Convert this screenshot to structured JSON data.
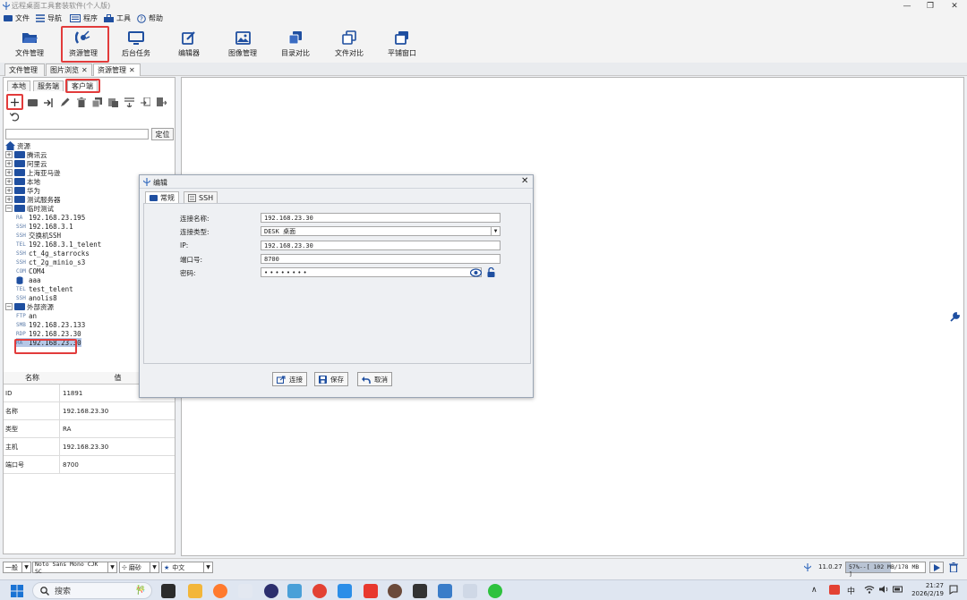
{
  "window": {
    "title": "远程桌面工具套装软件(个人版)"
  },
  "menubar": [
    {
      "label": "文件",
      "icon": "folder-icon"
    },
    {
      "label": "导航",
      "icon": "list-icon"
    },
    {
      "label": "程序",
      "icon": "keyboard-icon"
    },
    {
      "label": "工具",
      "icon": "toolbox-icon"
    },
    {
      "label": "帮助",
      "icon": "help-icon"
    }
  ],
  "toolbar": [
    {
      "label": "文件管理",
      "icon": "folder-open-icon"
    },
    {
      "label": "资源管理",
      "icon": "satellite-icon"
    },
    {
      "label": "后台任务",
      "icon": "monitor-icon"
    },
    {
      "label": "编辑器",
      "icon": "edit-icon"
    },
    {
      "label": "图像管理",
      "icon": "image-icon"
    },
    {
      "label": "目录对比",
      "icon": "copy-icon"
    },
    {
      "label": "文件对比",
      "icon": "files-icon"
    },
    {
      "label": "平铺窗口",
      "icon": "windows-icon"
    }
  ],
  "doc_tabs": [
    {
      "label": "文件管理",
      "closable": false
    },
    {
      "label": "图片浏览",
      "closable": true
    },
    {
      "label": "资源管理",
      "closable": true
    }
  ],
  "side_tabs": [
    "本地",
    "服务端",
    "客户端"
  ],
  "locate_button": "定位",
  "tree": {
    "root": "资源",
    "folders": [
      "腾讯云",
      "阿里云",
      "上海亚马逊",
      "本地",
      "华为",
      "测试服务器",
      "临时测试"
    ],
    "items": [
      {
        "tag": "RA",
        "label": "192.168.23.195"
      },
      {
        "tag": "SSH",
        "label": "192.168.3.1"
      },
      {
        "tag": "SSH",
        "label": "交换机SSH"
      },
      {
        "tag": "TEL",
        "label": "192.168.3.1_telent"
      },
      {
        "tag": "SSH",
        "label": "ct_4g_starrocks"
      },
      {
        "tag": "SSH",
        "label": "ct_2g_minio_s3"
      },
      {
        "tag": "COM",
        "label": "COM4"
      },
      {
        "tag": "DB",
        "label": "aaa"
      },
      {
        "tag": "TEL",
        "label": "test_telent"
      },
      {
        "tag": "SSH",
        "label": "anolis8"
      }
    ],
    "external_folder": "外部资源",
    "external_items": [
      {
        "tag": "FTP",
        "label": "an"
      },
      {
        "tag": "SMB",
        "label": "192.168.23.133"
      },
      {
        "tag": "RDP",
        "label": "192.168.23.30"
      },
      {
        "tag": "RA",
        "label": "192.168.23.30"
      }
    ]
  },
  "properties": {
    "headers": [
      "名称",
      "值"
    ],
    "rows": [
      [
        "ID",
        "11891"
      ],
      [
        "名称",
        "192.168.23.30"
      ],
      [
        "类型",
        "RA"
      ],
      [
        "主机",
        "192.168.23.30"
      ],
      [
        "端口号",
        "8700"
      ]
    ]
  },
  "dialog": {
    "title": "编辑",
    "tabs": [
      "常规",
      "SSH"
    ],
    "fields": [
      {
        "label": "连接名称:",
        "value": "192.168.23.30"
      },
      {
        "label": "连接类型:",
        "value": "DESK 桌面"
      },
      {
        "label": "IP:",
        "value": "192.168.23.30"
      },
      {
        "label": "端口号:",
        "value": "8700"
      },
      {
        "label": "密码:",
        "value": "••••••••"
      }
    ],
    "buttons": [
      "连接",
      "保存",
      "取消"
    ]
  },
  "statusbar": {
    "mode": "一般",
    "font": "Noto Sans Mono CJK SC",
    "style": "磨砂",
    "language": "中文",
    "version": "11.0.27",
    "memory": "57%--[ 102 MB/178 MB ]",
    "memory_percent": 57
  },
  "taskbar": {
    "search_placeholder": "搜索",
    "ime": "中",
    "time": "21:27",
    "date": "2026/2/19"
  },
  "colors": {
    "accent": "#1f4fa0",
    "highlight": "#e23b3b",
    "selection": "#b5c7e6"
  }
}
